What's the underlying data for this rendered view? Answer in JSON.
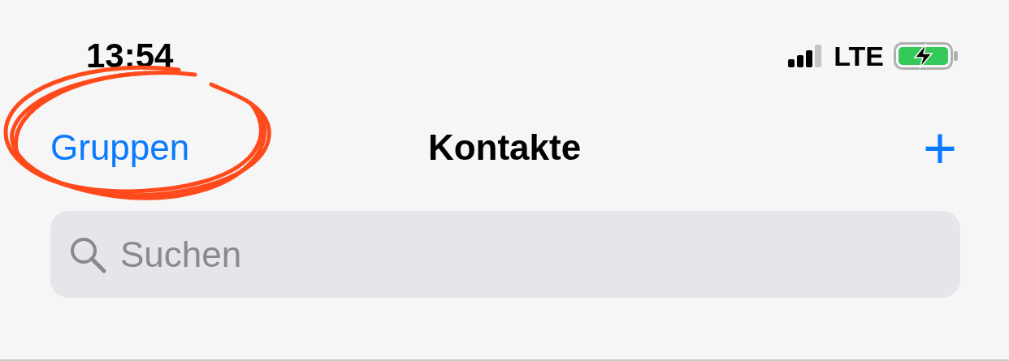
{
  "status_bar": {
    "time": "13:54",
    "network": "LTE"
  },
  "nav_bar": {
    "left_button": "Gruppen",
    "title": "Kontakte",
    "right_button": "+"
  },
  "search": {
    "placeholder": "Suchen"
  }
}
